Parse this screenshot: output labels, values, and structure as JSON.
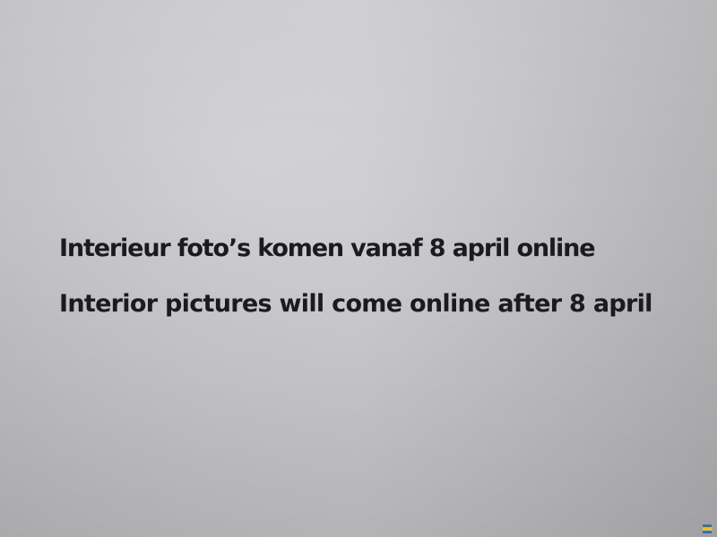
{
  "notice": {
    "line_dutch": "Interieur foto’s komen vanaf 8 april online",
    "line_english": "Interior pictures will come online after 8 april"
  },
  "colors": {
    "paper": "#c8c8cb",
    "text": "#1b1b1d"
  },
  "corner_mark": {
    "icon": "flag-mark-icon",
    "stripes": [
      "#2d6fd1",
      "#f2c200",
      "#2d6fd1"
    ]
  }
}
